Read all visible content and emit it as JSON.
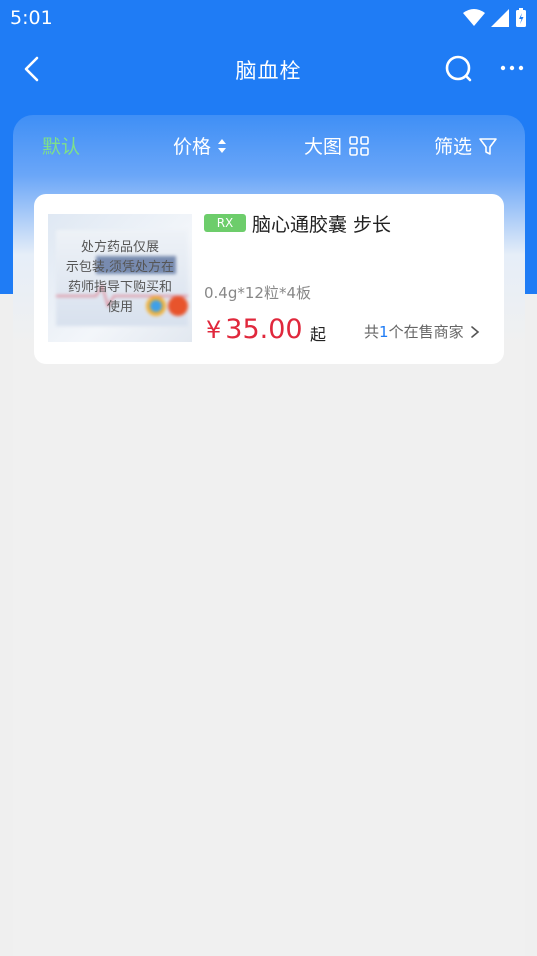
{
  "status_bar": {
    "time": "5:01",
    "icons": [
      "wifi-icon",
      "signal-icon",
      "battery-icon"
    ]
  },
  "nav": {
    "title": "脑血栓",
    "icons": [
      "back-icon",
      "search-icon",
      "more-icon"
    ]
  },
  "filters": {
    "default_label": "默认",
    "price_label": "价格",
    "bigimage_label": "大图",
    "filter_label": "筛选",
    "active_color": "#7ee08a"
  },
  "product": {
    "badge": "RX",
    "name": "脑心通胶囊 步长",
    "image_notice": [
      "处方药品仅展",
      "示包装,须凭处方在",
      "药师指导下购买和",
      "使用"
    ],
    "spec": "0.4g*12粒*4板",
    "currency": "¥",
    "price": "35.00",
    "price_suffix": "起",
    "sellers_prefix": "共",
    "sellers_count": "1",
    "sellers_suffix": "个在售商家"
  },
  "colors": {
    "primary": "#1f7cf5",
    "price": "#e0283c",
    "rx_badge": "#6dcd6b"
  }
}
